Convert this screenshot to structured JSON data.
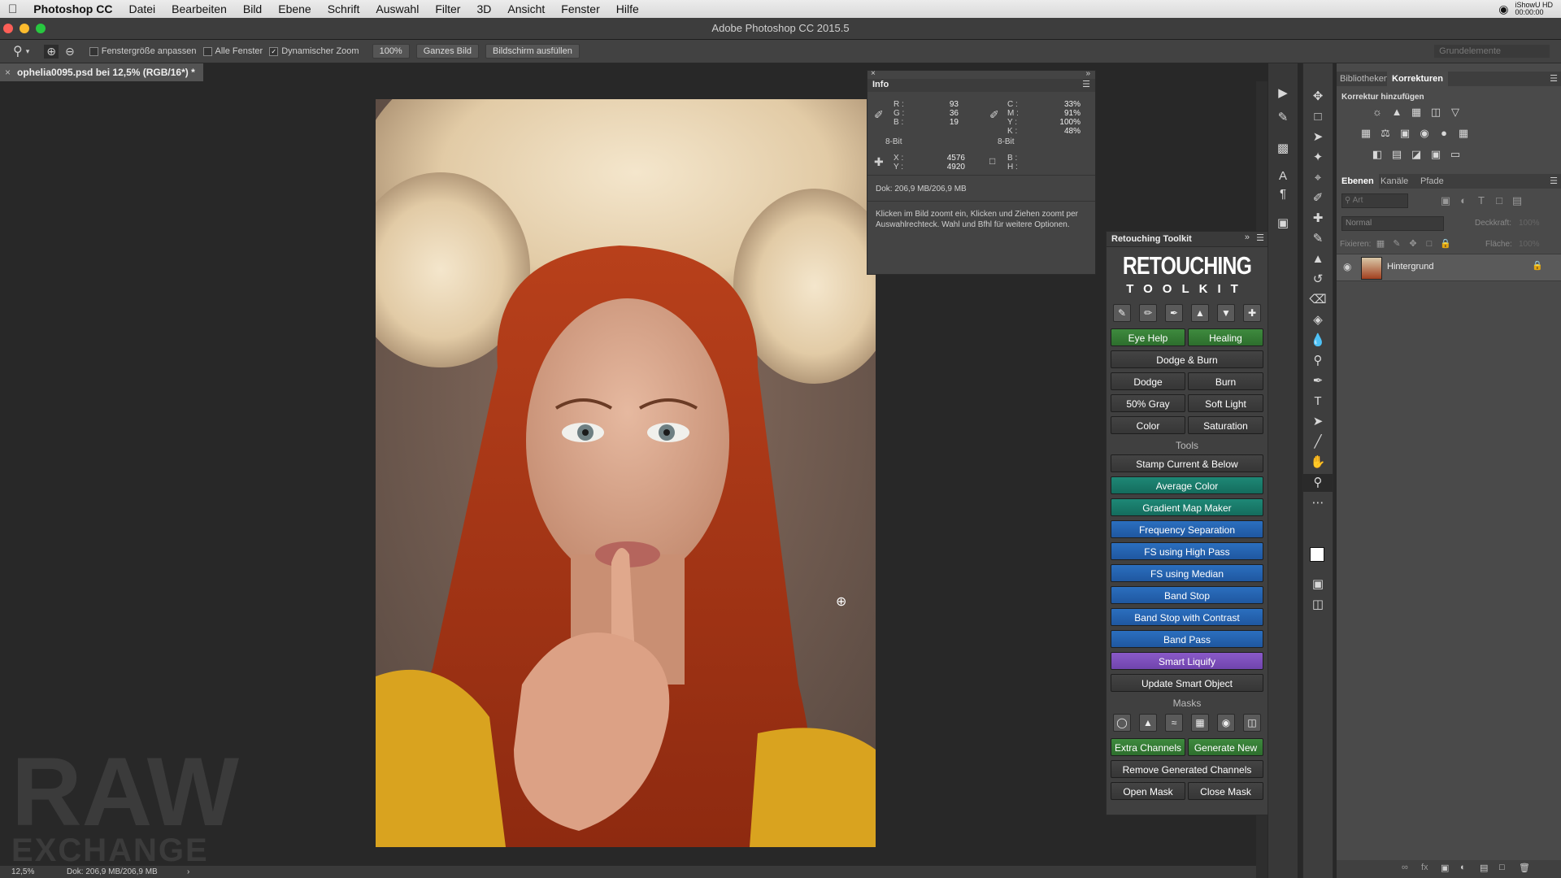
{
  "menubar": {
    "app": "Photoshop CC",
    "items": [
      "Datei",
      "Bearbeiten",
      "Bild",
      "Ebene",
      "Schrift",
      "Auswahl",
      "Filter",
      "3D",
      "Ansicht",
      "Fenster",
      "Hilfe"
    ],
    "status_line1": "iShowU HD",
    "status_line2": "00:00:00"
  },
  "window": {
    "title": "Adobe Photoshop CC 2015.5"
  },
  "options": {
    "fit_window_label": "Fenstergröße anpassen",
    "all_windows_label": "Alle Fenster",
    "scrubby_zoom_label": "Dynamischer Zoom",
    "zoom_100": "100%",
    "fit_screen": "Ganzes Bild",
    "fill_screen": "Bildschirm ausfüllen",
    "workspace": "Grundelemente"
  },
  "document": {
    "tab_title": "ophelia0095.psd bei 12,5% (RGB/16*) *",
    "status_zoom": "12,5%",
    "status_doc": "Dok: 206,9 MB/206,9 MB"
  },
  "info": {
    "title": "Info",
    "rgb_labels": [
      "R :",
      "G :",
      "B :"
    ],
    "rgb_values": [
      "93",
      "36",
      "19"
    ],
    "cmyk_labels": [
      "C :",
      "M :",
      "Y :",
      "K :"
    ],
    "cmyk_values": [
      "33%",
      "91%",
      "100%",
      "48%"
    ],
    "bitdepth_left": "8-Bit",
    "bitdepth_right": "8-Bit",
    "xy_labels": [
      "X :",
      "Y :"
    ],
    "xy_values": [
      "4576",
      "4920"
    ],
    "wh_labels": [
      "B :",
      "H :"
    ],
    "doc": "Dok: 206,9 MB/206,9 MB",
    "hint": "Klicken im Bild zoomt ein, Klicken und Ziehen zoomt per Auswahlrechteck. Wahl und Bfhl für weitere Optionen."
  },
  "toolkit": {
    "title": "Retouching Toolkit",
    "logo_line1": "RETOUCHING",
    "logo_line2": "TOOLKIT",
    "eye_help": "Eye Help",
    "healing": "Healing",
    "dodge_burn": "Dodge & Burn",
    "dodge": "Dodge",
    "burn": "Burn",
    "gray50": "50% Gray",
    "soft_light": "Soft Light",
    "color": "Color",
    "saturation": "Saturation",
    "tools_header": "Tools",
    "stamp": "Stamp Current & Below",
    "avg_color": "Average Color",
    "gradient_map": "Gradient Map Maker",
    "freq_sep": "Frequency Separation",
    "fs_highpass": "FS using High Pass",
    "fs_median": "FS using Median",
    "band_stop": "Band Stop",
    "band_stop_contrast": "Band Stop with Contrast",
    "band_pass": "Band Pass",
    "smart_liquify": "Smart Liquify",
    "update_smart": "Update Smart Object",
    "masks_header": "Masks",
    "extra_channels": "Extra Channels",
    "generate_new": "Generate New",
    "remove_channels": "Remove Generated Channels",
    "open_mask": "Open Mask",
    "close_mask": "Close Mask"
  },
  "right": {
    "tab_libraries": "Bibliotheken",
    "tab_adjustments": "Korrekturen",
    "add_adjustment": "Korrektur hinzufügen",
    "tab_layers": "Ebenen",
    "tab_channels": "Kanäle",
    "tab_paths": "Pfade",
    "filter_placeholder": "Art",
    "blend_mode": "Normal",
    "opacity_label": "Deckkraft:",
    "opacity_value": "100%",
    "lock_label": "Fixieren:",
    "fill_label": "Fläche:",
    "fill_value": "100%",
    "layer_name": "Hintergrund"
  },
  "watermark": {
    "line1": "RAW",
    "line2": "EXCHANGE"
  },
  "colors": {
    "accent_green": "#3e8a3e",
    "accent_teal": "#1e8876",
    "accent_blue": "#2b6fbf",
    "accent_purple": "#8a5ac8"
  }
}
